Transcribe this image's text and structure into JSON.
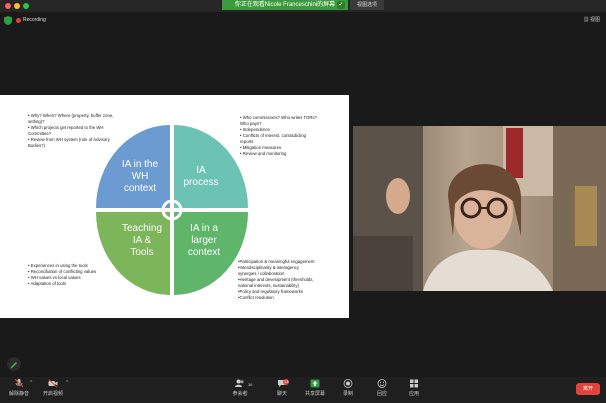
{
  "window": {
    "banner_text": "你正在观看Nicole Franceschini的屏幕",
    "view_options_label": "视图选项",
    "recording_label": "Recording",
    "view_label": "视图"
  },
  "slide": {
    "top_left": [
      "• Why? When? Where (property, buffer zone,",
      "  setting)?",
      "• Which projects get reported to the WH",
      "  Committee?",
      "• Review from WH system (role of Advisory",
      "  Bodies?)"
    ],
    "top_right": [
      "• Who commissions? Who writes TORs?",
      "  Who pays?",
      "• Independence",
      "• Conflicts of interest, contradicting",
      "  reports",
      "• Mitigation measures",
      "• Review and monitoring"
    ],
    "bottom_left": [
      "• Experiences in using the tools",
      "• Reconciliation of conflicting values",
      "• WH values vs local values",
      "• Adaptation of tools"
    ],
    "bottom_right": [
      "•Participation & meaningful engagement",
      "•Interdisciplinarity & interagency",
      " synergies / collaboration",
      "•Heritage and development (thresholds,",
      " national interests, sustainability)",
      "•Policy and regulatory frameworks",
      "•Conflict resolution"
    ],
    "quadrants": {
      "q1": [
        "IA in the",
        "WH",
        "context"
      ],
      "q2": [
        "IA",
        "process"
      ],
      "q3": [
        "Teaching",
        "IA &",
        "Tools"
      ],
      "q4": [
        "IA in a",
        "larger",
        "context"
      ]
    },
    "colors": {
      "q1": "#6b9bd1",
      "q2": "#6cc3b4",
      "q3": "#7cb55a",
      "q4": "#5fb56a"
    }
  },
  "toolbar": {
    "mute": "解除静音",
    "video": "开启视频",
    "participants": "参会者",
    "participants_count": "36",
    "chat": "聊天",
    "chat_badge": "13",
    "share": "共享屏幕",
    "record": "录制",
    "reactions": "回应",
    "apps": "应用",
    "leave": "离开"
  }
}
